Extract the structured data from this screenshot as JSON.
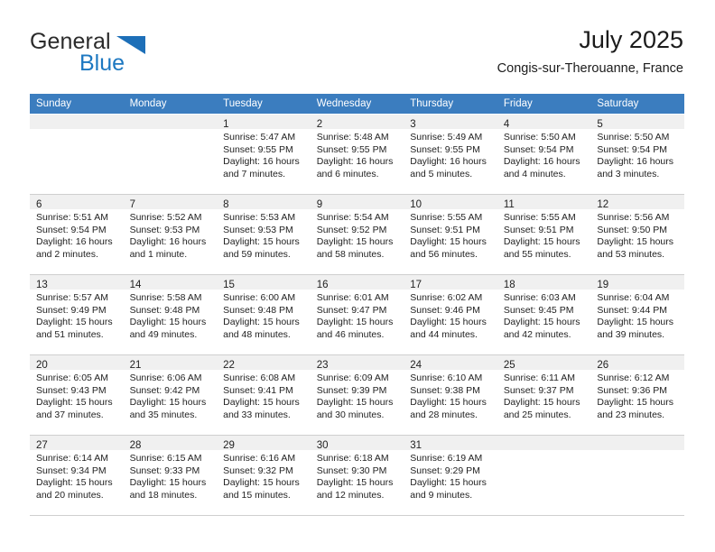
{
  "brand": {
    "name_top": "General",
    "name_bottom": "Blue",
    "triangle_color": "#1d6fb8",
    "blue_color": "#1d78c1"
  },
  "header": {
    "title": "July 2025",
    "location": "Congis-sur-Therouanne, France"
  },
  "theme": {
    "header_bg": "#3b7dbf",
    "header_text": "#ffffff",
    "daynum_strip_bg": "#f0f0f0",
    "cell_border": "#cfcfcf"
  },
  "weekday_headers": [
    "Sunday",
    "Monday",
    "Tuesday",
    "Wednesday",
    "Thursday",
    "Friday",
    "Saturday"
  ],
  "weeks": [
    [
      {
        "day": "",
        "lines": []
      },
      {
        "day": "",
        "lines": []
      },
      {
        "day": "1",
        "lines": [
          "Sunrise: 5:47 AM",
          "Sunset: 9:55 PM",
          "Daylight: 16 hours",
          "and 7 minutes."
        ]
      },
      {
        "day": "2",
        "lines": [
          "Sunrise: 5:48 AM",
          "Sunset: 9:55 PM",
          "Daylight: 16 hours",
          "and 6 minutes."
        ]
      },
      {
        "day": "3",
        "lines": [
          "Sunrise: 5:49 AM",
          "Sunset: 9:55 PM",
          "Daylight: 16 hours",
          "and 5 minutes."
        ]
      },
      {
        "day": "4",
        "lines": [
          "Sunrise: 5:50 AM",
          "Sunset: 9:54 PM",
          "Daylight: 16 hours",
          "and 4 minutes."
        ]
      },
      {
        "day": "5",
        "lines": [
          "Sunrise: 5:50 AM",
          "Sunset: 9:54 PM",
          "Daylight: 16 hours",
          "and 3 minutes."
        ]
      }
    ],
    [
      {
        "day": "6",
        "lines": [
          "Sunrise: 5:51 AM",
          "Sunset: 9:54 PM",
          "Daylight: 16 hours",
          "and 2 minutes."
        ]
      },
      {
        "day": "7",
        "lines": [
          "Sunrise: 5:52 AM",
          "Sunset: 9:53 PM",
          "Daylight: 16 hours",
          "and 1 minute."
        ]
      },
      {
        "day": "8",
        "lines": [
          "Sunrise: 5:53 AM",
          "Sunset: 9:53 PM",
          "Daylight: 15 hours",
          "and 59 minutes."
        ]
      },
      {
        "day": "9",
        "lines": [
          "Sunrise: 5:54 AM",
          "Sunset: 9:52 PM",
          "Daylight: 15 hours",
          "and 58 minutes."
        ]
      },
      {
        "day": "10",
        "lines": [
          "Sunrise: 5:55 AM",
          "Sunset: 9:51 PM",
          "Daylight: 15 hours",
          "and 56 minutes."
        ]
      },
      {
        "day": "11",
        "lines": [
          "Sunrise: 5:55 AM",
          "Sunset: 9:51 PM",
          "Daylight: 15 hours",
          "and 55 minutes."
        ]
      },
      {
        "day": "12",
        "lines": [
          "Sunrise: 5:56 AM",
          "Sunset: 9:50 PM",
          "Daylight: 15 hours",
          "and 53 minutes."
        ]
      }
    ],
    [
      {
        "day": "13",
        "lines": [
          "Sunrise: 5:57 AM",
          "Sunset: 9:49 PM",
          "Daylight: 15 hours",
          "and 51 minutes."
        ]
      },
      {
        "day": "14",
        "lines": [
          "Sunrise: 5:58 AM",
          "Sunset: 9:48 PM",
          "Daylight: 15 hours",
          "and 49 minutes."
        ]
      },
      {
        "day": "15",
        "lines": [
          "Sunrise: 6:00 AM",
          "Sunset: 9:48 PM",
          "Daylight: 15 hours",
          "and 48 minutes."
        ]
      },
      {
        "day": "16",
        "lines": [
          "Sunrise: 6:01 AM",
          "Sunset: 9:47 PM",
          "Daylight: 15 hours",
          "and 46 minutes."
        ]
      },
      {
        "day": "17",
        "lines": [
          "Sunrise: 6:02 AM",
          "Sunset: 9:46 PM",
          "Daylight: 15 hours",
          "and 44 minutes."
        ]
      },
      {
        "day": "18",
        "lines": [
          "Sunrise: 6:03 AM",
          "Sunset: 9:45 PM",
          "Daylight: 15 hours",
          "and 42 minutes."
        ]
      },
      {
        "day": "19",
        "lines": [
          "Sunrise: 6:04 AM",
          "Sunset: 9:44 PM",
          "Daylight: 15 hours",
          "and 39 minutes."
        ]
      }
    ],
    [
      {
        "day": "20",
        "lines": [
          "Sunrise: 6:05 AM",
          "Sunset: 9:43 PM",
          "Daylight: 15 hours",
          "and 37 minutes."
        ]
      },
      {
        "day": "21",
        "lines": [
          "Sunrise: 6:06 AM",
          "Sunset: 9:42 PM",
          "Daylight: 15 hours",
          "and 35 minutes."
        ]
      },
      {
        "day": "22",
        "lines": [
          "Sunrise: 6:08 AM",
          "Sunset: 9:41 PM",
          "Daylight: 15 hours",
          "and 33 minutes."
        ]
      },
      {
        "day": "23",
        "lines": [
          "Sunrise: 6:09 AM",
          "Sunset: 9:39 PM",
          "Daylight: 15 hours",
          "and 30 minutes."
        ]
      },
      {
        "day": "24",
        "lines": [
          "Sunrise: 6:10 AM",
          "Sunset: 9:38 PM",
          "Daylight: 15 hours",
          "and 28 minutes."
        ]
      },
      {
        "day": "25",
        "lines": [
          "Sunrise: 6:11 AM",
          "Sunset: 9:37 PM",
          "Daylight: 15 hours",
          "and 25 minutes."
        ]
      },
      {
        "day": "26",
        "lines": [
          "Sunrise: 6:12 AM",
          "Sunset: 9:36 PM",
          "Daylight: 15 hours",
          "and 23 minutes."
        ]
      }
    ],
    [
      {
        "day": "27",
        "lines": [
          "Sunrise: 6:14 AM",
          "Sunset: 9:34 PM",
          "Daylight: 15 hours",
          "and 20 minutes."
        ]
      },
      {
        "day": "28",
        "lines": [
          "Sunrise: 6:15 AM",
          "Sunset: 9:33 PM",
          "Daylight: 15 hours",
          "and 18 minutes."
        ]
      },
      {
        "day": "29",
        "lines": [
          "Sunrise: 6:16 AM",
          "Sunset: 9:32 PM",
          "Daylight: 15 hours",
          "and 15 minutes."
        ]
      },
      {
        "day": "30",
        "lines": [
          "Sunrise: 6:18 AM",
          "Sunset: 9:30 PM",
          "Daylight: 15 hours",
          "and 12 minutes."
        ]
      },
      {
        "day": "31",
        "lines": [
          "Sunrise: 6:19 AM",
          "Sunset: 9:29 PM",
          "Daylight: 15 hours",
          "and 9 minutes."
        ]
      },
      {
        "day": "",
        "lines": []
      },
      {
        "day": "",
        "lines": []
      }
    ]
  ]
}
